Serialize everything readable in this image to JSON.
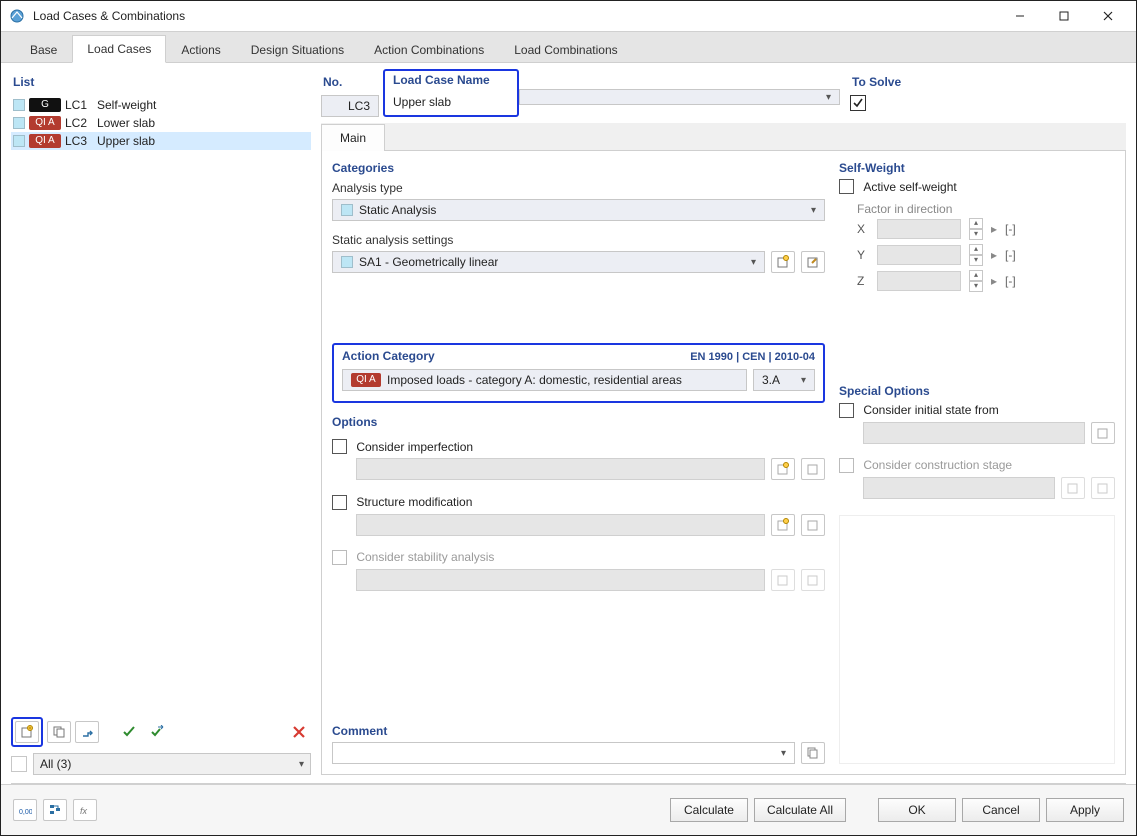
{
  "window": {
    "title": "Load Cases & Combinations"
  },
  "tabs": {
    "items": [
      "Base",
      "Load Cases",
      "Actions",
      "Design Situations",
      "Action Combinations",
      "Load Combinations"
    ],
    "active_index": 1
  },
  "left": {
    "title": "List",
    "items": [
      {
        "tag_style": "g",
        "tag": "G",
        "id": "LC1",
        "name": "Self-weight"
      },
      {
        "tag_style": "qia",
        "tag": "QI A",
        "id": "LC2",
        "name": "Lower slab"
      },
      {
        "tag_style": "qia",
        "tag": "QI A",
        "id": "LC3",
        "name": "Upper slab"
      }
    ],
    "selected_index": 2,
    "toolbar": {
      "new_icon": "new-item-icon",
      "copy_icon": "copy-item-icon",
      "arrow_icon": "move-icon",
      "check1_icon": "check-green-icon",
      "check2_icon": "check-toggle-icon",
      "delete_icon": "delete-icon"
    },
    "filter_label": "All (3)"
  },
  "header_fields": {
    "no_label": "No.",
    "no_value": "LC3",
    "name_label": "Load Case Name",
    "name_value": "Upper slab",
    "to_solve_label": "To Solve",
    "to_solve_checked": true
  },
  "sub_tab": {
    "label": "Main"
  },
  "categories": {
    "title": "Categories",
    "analysis_type_label": "Analysis type",
    "analysis_type_value": "Static Analysis",
    "settings_label": "Static analysis settings",
    "settings_value": "SA1 - Geometrically linear"
  },
  "action_category": {
    "title": "Action Category",
    "standard": "EN 1990 | CEN | 2010-04",
    "tag": "QI A",
    "desc": "Imposed loads - category A: domestic, residential areas",
    "code": "3.A"
  },
  "options": {
    "title": "Options",
    "imperfection": "Consider imperfection",
    "structure_mod": "Structure modification",
    "stability": "Consider stability analysis"
  },
  "comment": {
    "title": "Comment"
  },
  "self_weight": {
    "title": "Self-Weight",
    "active_label": "Active self-weight",
    "factor_label": "Factor in direction",
    "axes": {
      "x": "X",
      "y": "Y",
      "z": "Z"
    },
    "unit": "[-]"
  },
  "special_options": {
    "title": "Special Options",
    "initial_state": "Consider initial state from",
    "construction_stage": "Consider construction stage"
  },
  "footer": {
    "calculate": "Calculate",
    "calculate_all": "Calculate All",
    "ok": "OK",
    "cancel": "Cancel",
    "apply": "Apply"
  }
}
